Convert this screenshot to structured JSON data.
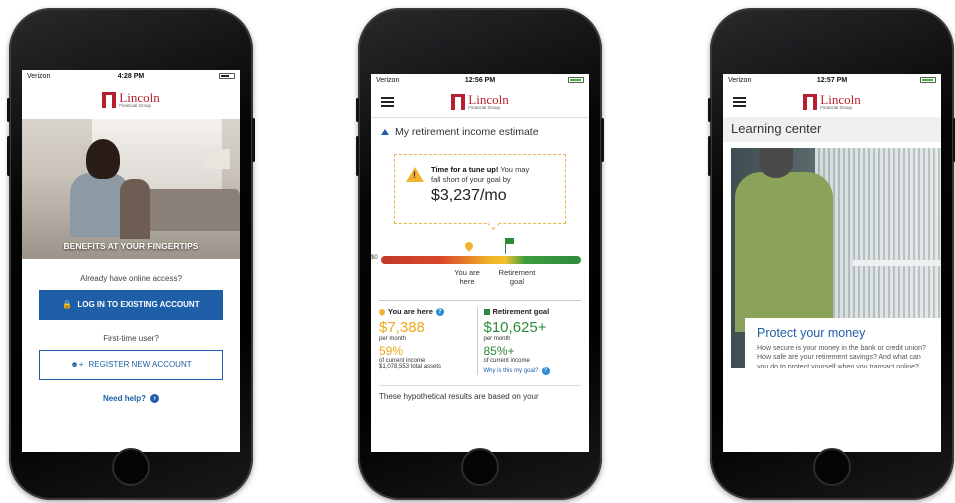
{
  "brand": {
    "name": "Lincoln",
    "sub": "Financial Group"
  },
  "phone1": {
    "status": {
      "carrier": "Verizon",
      "time": "4:28 PM"
    },
    "hero_caption": "BENEFITS AT YOUR FINGERTIPS",
    "question_existing": "Already have online access?",
    "login_label": "LOG IN TO EXISTING ACCOUNT",
    "question_new": "First-time user?",
    "register_label": "REGISTER NEW ACCOUNT",
    "help_label": "Need help?"
  },
  "phone2": {
    "status": {
      "carrier": "Verizon",
      "time": "12:56 PM"
    },
    "section_title": "My retirement income estimate",
    "alert": {
      "line1": "Time for a tune up!",
      "line1_rest": " You may",
      "line2": "fall short of your goal by",
      "amount": "$3,237/mo"
    },
    "gauge": {
      "zero_label": "$0",
      "here_label_1": "You are",
      "here_label_2": "here",
      "goal_label_1": "Retirement",
      "goal_label_2": "goal",
      "here_fraction": 0.41,
      "goal_fraction": 0.6
    },
    "you_are_here": {
      "heading": "You are here",
      "monthly": "$7,388",
      "per_month": "per month",
      "percent": "59%",
      "of_income": "of current income",
      "total_assets": "$1,078,553 total assets"
    },
    "retirement_goal": {
      "heading": "Retirement goal",
      "monthly": "$10,625+",
      "per_month": "per month",
      "percent": "85%+",
      "of_income": "of current income",
      "link": "Why is this my goal?"
    },
    "footer_text": "These hypothetical results are based on your"
  },
  "phone3": {
    "status": {
      "carrier": "Verizon",
      "time": "12:57 PM"
    },
    "page_title": "Learning center",
    "card_title": "Protect your money",
    "card_text": "How secure is your money in the bank or credit union? How safe are your retirement savings? And what can you do to protect yourself when you transact online? Here are some tips for keeping your money safe this holiday season."
  },
  "colors": {
    "brand_red": "#b5202e",
    "link_blue": "#1f5fa8",
    "warning_yellow": "#f0a818",
    "goal_green": "#2e8b3a"
  }
}
